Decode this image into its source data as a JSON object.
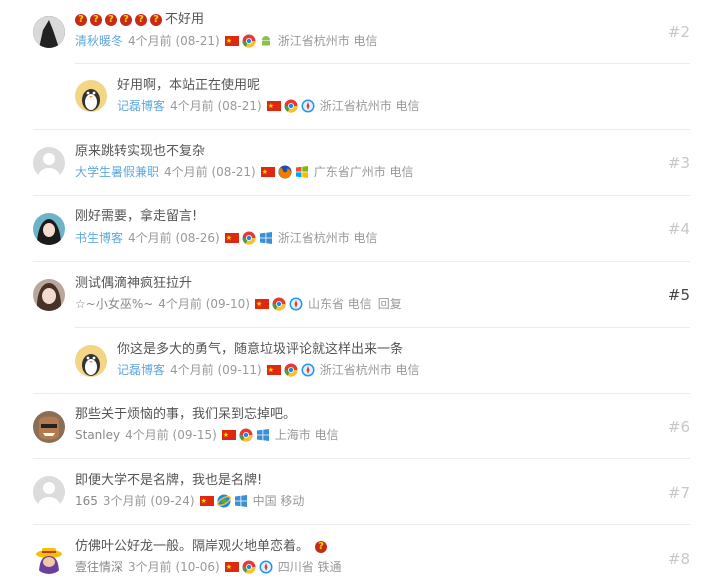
{
  "comments": [
    {
      "text": "不好用",
      "author": "清秋暖冬",
      "time": "4个月前 (08-21)",
      "browser": "chrome",
      "os": "android",
      "location": "浙江省杭州市 电信",
      "number": "#2",
      "qmarks": "??????"
    },
    {
      "text": "好用啊，本站正在使用呢",
      "author": "记磊博客",
      "time": "4个月前 (08-21)",
      "browser": "chrome",
      "os": "safari",
      "location": "浙江省杭州市 电信"
    },
    {
      "text": "原来跳转实现也不复杂",
      "author": "大学生暑假兼职",
      "time": "4个月前 (08-21)",
      "browser": "firefox",
      "os": "windows",
      "location": "广东省广州市 电信",
      "number": "#3"
    },
    {
      "text": "刚好需要，拿走留言!",
      "author": "书生博客",
      "time": "4个月前 (08-26)",
      "browser": "chrome",
      "os": "windows",
      "location": "浙江省杭州市 电信",
      "number": "#4"
    },
    {
      "text": "测试偶滴神疯狂拉升",
      "author": "☆~小女巫%~",
      "time": "4个月前 (09-10)",
      "browser": "chrome",
      "os": "safari",
      "location": "山东省 电信",
      "reply": "回复",
      "number": "#5"
    },
    {
      "text": "你这是多大的勇气，随意垃圾评论就这样出来一条",
      "author": "记磊博客",
      "time": "4个月前 (09-11)",
      "browser": "chrome",
      "os": "safari",
      "location": "浙江省杭州市 电信"
    },
    {
      "text": "那些关于烦恼的事，我们呆到忘掉吧。",
      "author": "Stanley",
      "time": "4个月前 (09-15)",
      "browser": "chrome",
      "os": "windows",
      "location": "上海市 电信",
      "number": "#6"
    },
    {
      "text": "即便大学不是名牌，我也是名牌!",
      "author": "165",
      "time": "3个月前 (09-24)",
      "browser": "ie",
      "os": "windows",
      "location": "中国 移动",
      "number": "#7"
    },
    {
      "text": "仿佛叶公好龙一般。隔岸观火地单恋着。",
      "author": "壹往情深",
      "time": "3个月前 (10-06)",
      "browser": "chrome",
      "os": "safari",
      "location": "四川省 铁通",
      "number": "#8",
      "trailing_qmark": "?"
    }
  ]
}
